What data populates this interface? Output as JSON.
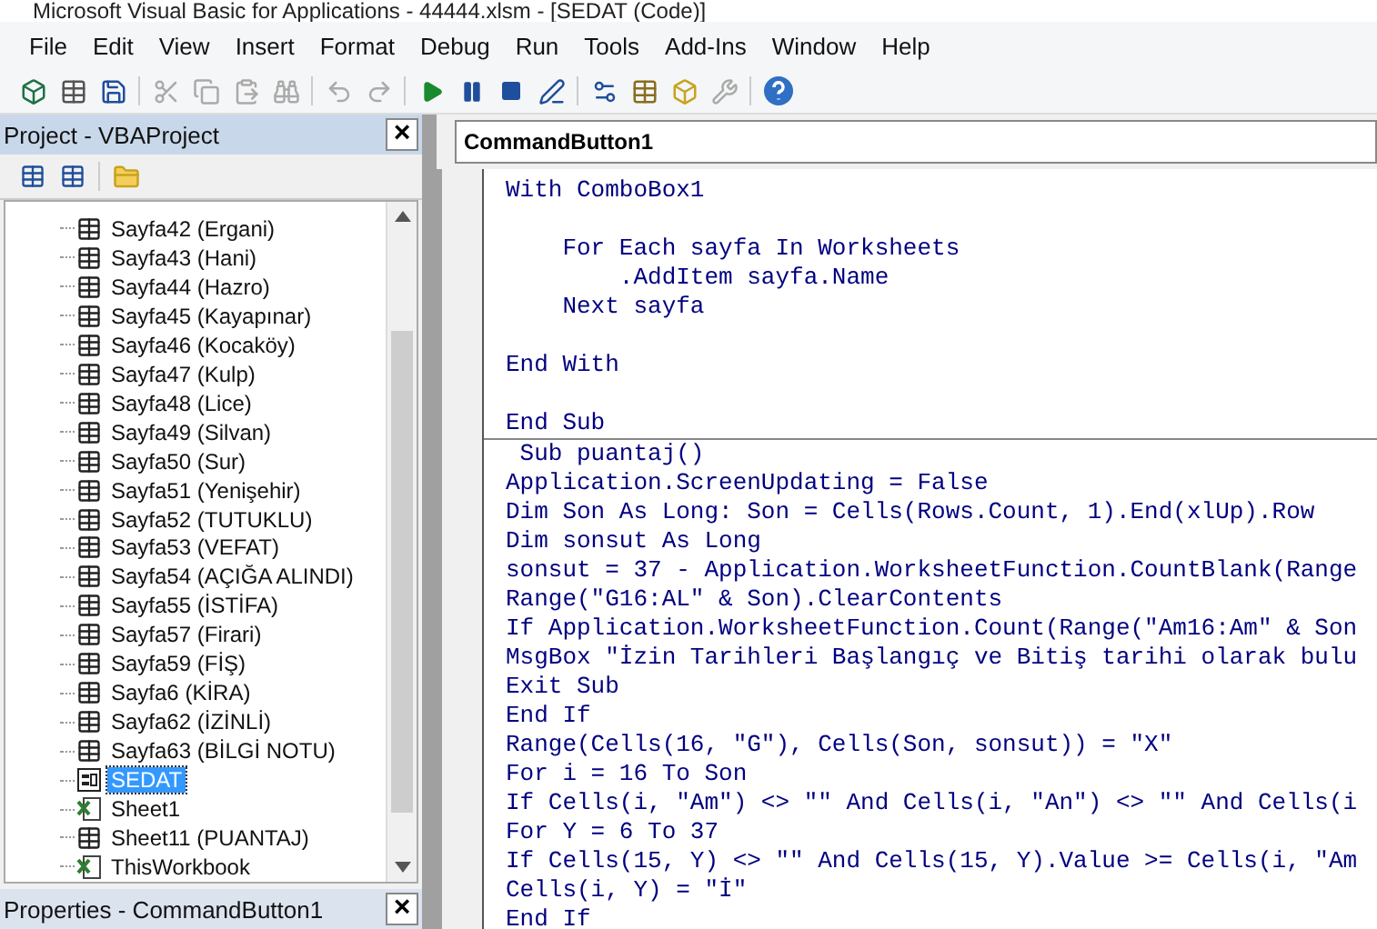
{
  "window": {
    "title": "Microsoft Visual Basic for Applications - 44444.xlsm - [SEDAT (Code)]"
  },
  "menu": [
    "File",
    "Edit",
    "View",
    "Insert",
    "Format",
    "Debug",
    "Run",
    "Tools",
    "Add-Ins",
    "Window",
    "Help"
  ],
  "project_panel": {
    "title": "Project - VBAProject",
    "close": "×",
    "items": [
      {
        "label": "Sayfa42 (Ergani)",
        "kind": "sheet",
        "selected": false
      },
      {
        "label": "Sayfa43 (Hani)",
        "kind": "sheet",
        "selected": false
      },
      {
        "label": "Sayfa44 (Hazro)",
        "kind": "sheet",
        "selected": false
      },
      {
        "label": "Sayfa45 (Kayapınar)",
        "kind": "sheet",
        "selected": false
      },
      {
        "label": "Sayfa46 (Kocaköy)",
        "kind": "sheet",
        "selected": false
      },
      {
        "label": "Sayfa47 (Kulp)",
        "kind": "sheet",
        "selected": false
      },
      {
        "label": "Sayfa48 (Lice)",
        "kind": "sheet",
        "selected": false
      },
      {
        "label": "Sayfa49 (Silvan)",
        "kind": "sheet",
        "selected": false
      },
      {
        "label": "Sayfa50 (Sur)",
        "kind": "sheet",
        "selected": false
      },
      {
        "label": "Sayfa51 (Yenişehir)",
        "kind": "sheet",
        "selected": false
      },
      {
        "label": "Sayfa52 (TUTUKLU)",
        "kind": "sheet",
        "selected": false
      },
      {
        "label": "Sayfa53 (VEFAT)",
        "kind": "sheet",
        "selected": false
      },
      {
        "label": "Sayfa54 (AÇIĞA ALINDI)",
        "kind": "sheet",
        "selected": false
      },
      {
        "label": "Sayfa55 (İSTİFA)",
        "kind": "sheet",
        "selected": false
      },
      {
        "label": "Sayfa57 (Firari)",
        "kind": "sheet",
        "selected": false
      },
      {
        "label": "Sayfa59 (FİŞ)",
        "kind": "sheet",
        "selected": false
      },
      {
        "label": "Sayfa6 (KİRA)",
        "kind": "sheet",
        "selected": false
      },
      {
        "label": "Sayfa62 (İZİNLİ)",
        "kind": "sheet",
        "selected": false
      },
      {
        "label": "Sayfa63 (BİLGİ NOTU)",
        "kind": "sheet",
        "selected": false
      },
      {
        "label": "SEDAT",
        "kind": "form",
        "selected": true
      },
      {
        "label": "Sheet1",
        "kind": "workbook",
        "selected": false
      },
      {
        "label": "Sheet11 (PUANTAJ)",
        "kind": "sheet",
        "selected": false
      },
      {
        "label": "ThisWorkbook",
        "kind": "workbook",
        "selected": false
      }
    ]
  },
  "properties_panel": {
    "title": "Properties - CommandButton1",
    "close": "×"
  },
  "code_window": {
    "object": "CommandButton1",
    "blocks": [
      [
        {
          "kind": "code",
          "text": "With ComboBox1"
        },
        {
          "kind": "blank"
        },
        {
          "kind": "code",
          "text": "    For Each sayfa In Worksheets"
        },
        {
          "kind": "code",
          "text": "        .AddItem sayfa.Name"
        },
        {
          "kind": "code",
          "text": "    Next sayfa"
        },
        {
          "kind": "blank"
        },
        {
          "kind": "code",
          "text": "End With"
        },
        {
          "kind": "blank"
        },
        {
          "kind": "code",
          "text": "End Sub"
        }
      ],
      [
        {
          "kind": "code",
          "text": " Sub puantaj()"
        },
        {
          "kind": "code",
          "text": "Application.ScreenUpdating = False"
        },
        {
          "kind": "code",
          "text": "Dim Son As Long: Son = Cells(Rows.Count, 1).End(xlUp).Row"
        },
        {
          "kind": "code",
          "text": "Dim sonsut As Long"
        },
        {
          "kind": "code",
          "text": "sonsut = 37 - Application.WorksheetFunction.CountBlank(Range"
        },
        {
          "kind": "code",
          "text": "Range(\"G16:AL\" & Son).ClearContents"
        },
        {
          "kind": "code",
          "text": "If Application.WorksheetFunction.Count(Range(\"Am16:Am\" & Son"
        },
        {
          "kind": "code",
          "text": "MsgBox \"İzin Tarihleri Başlangıç ve Bitiş tarihi olarak bulu"
        },
        {
          "kind": "code",
          "text": "Exit Sub"
        },
        {
          "kind": "code",
          "text": "End If"
        },
        {
          "kind": "code",
          "text": "Range(Cells(16, \"G\"), Cells(Son, sonsut)) = \"X\""
        },
        {
          "kind": "code",
          "text": "For i = 16 To Son"
        },
        {
          "kind": "code",
          "text": "If Cells(i, \"Am\") <> \"\" And Cells(i, \"An\") <> \"\" And Cells(i"
        },
        {
          "kind": "code",
          "text": "For Y = 6 To 37"
        },
        {
          "kind": "code",
          "text": "If Cells(15, Y) <> \"\" And Cells(15, Y).Value >= Cells(i, \"Am"
        },
        {
          "kind": "code",
          "text": "Cells(i, Y) = \"İ\""
        },
        {
          "kind": "code",
          "text": "End If"
        }
      ]
    ]
  }
}
